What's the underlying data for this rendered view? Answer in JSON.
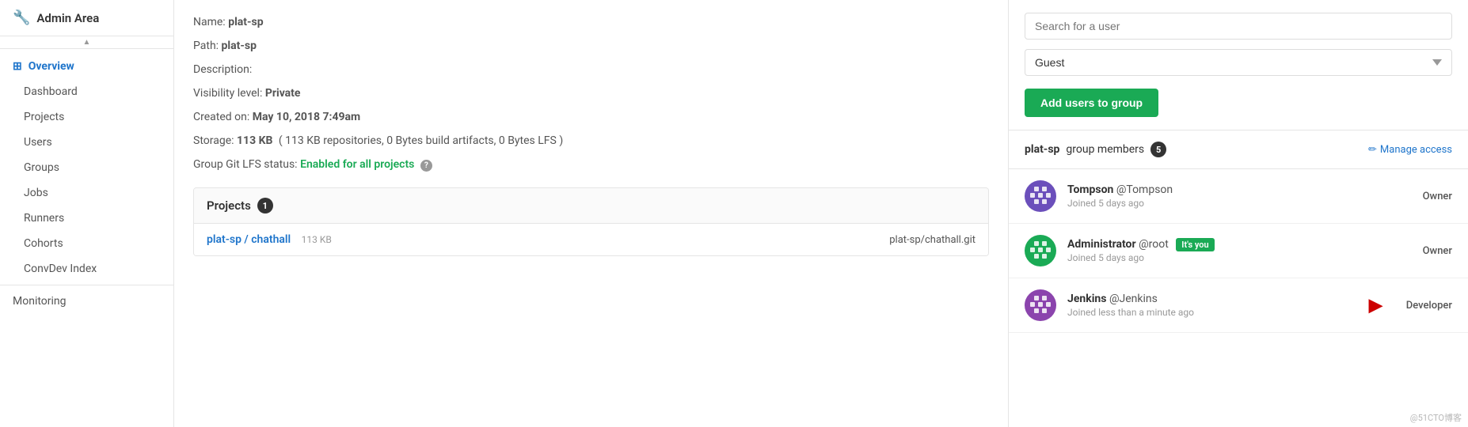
{
  "sidebar": {
    "header": {
      "title": "Admin Area",
      "icon": "wrench"
    },
    "items": [
      {
        "id": "overview",
        "label": "Overview",
        "icon": "grid",
        "active": true,
        "class": "overview"
      },
      {
        "id": "dashboard",
        "label": "Dashboard",
        "icon": "",
        "active": false
      },
      {
        "id": "projects",
        "label": "Projects",
        "icon": "",
        "active": false
      },
      {
        "id": "users",
        "label": "Users",
        "icon": "",
        "active": false
      },
      {
        "id": "groups",
        "label": "Groups",
        "icon": "",
        "active": false,
        "highlighted": true
      },
      {
        "id": "jobs",
        "label": "Jobs",
        "icon": "",
        "active": false
      },
      {
        "id": "runners",
        "label": "Runners",
        "icon": "",
        "active": false
      },
      {
        "id": "cohorts",
        "label": "Cohorts",
        "icon": "",
        "active": false
      },
      {
        "id": "convdev",
        "label": "ConvDev Index",
        "icon": "",
        "active": false
      }
    ],
    "sections": [
      {
        "id": "monitoring",
        "label": "Monitoring"
      }
    ]
  },
  "group_detail": {
    "name_label": "Name:",
    "name_value": "plat-sp",
    "path_label": "Path:",
    "path_value": "plat-sp",
    "description_label": "Description:",
    "description_value": "",
    "visibility_label": "Visibility level:",
    "visibility_value": "Private",
    "created_label": "Created on:",
    "created_value": "May 10, 2018 7:49am",
    "storage_label": "Storage:",
    "storage_value": "113 KB",
    "storage_detail": "( 113 KB repositories, 0 Bytes build artifacts, 0 Bytes LFS )",
    "lfs_label": "Group Git LFS status:",
    "lfs_value": "Enabled for all projects"
  },
  "projects_section": {
    "title": "Projects",
    "count": "1",
    "project": {
      "link_text": "plat-sp / chathall",
      "size": "113 KB",
      "git_url": "plat-sp/chathall.git"
    }
  },
  "add_users": {
    "search_placeholder": "Search for a user",
    "role_value": "Guest",
    "button_label": "Add users to group"
  },
  "members": {
    "group_name": "plat-sp",
    "label": "group members",
    "count": "5",
    "manage_link": "Manage access",
    "list": [
      {
        "name": "Tompson",
        "username": "@Tompson",
        "joined": "Joined 5 days ago",
        "role": "Owner",
        "avatar_color": "#6b4fbb",
        "its_you": false
      },
      {
        "name": "Administrator",
        "username": "@root",
        "joined": "Joined 5 days ago",
        "role": "Owner",
        "avatar_color": "#1aaa55",
        "its_you": true,
        "its_you_label": "It's you"
      },
      {
        "name": "Jenkins",
        "username": "@Jenkins",
        "joined": "Joined less than a minute ago",
        "role": "Developer",
        "avatar_color": "#8b44ad",
        "its_you": false
      }
    ]
  },
  "watermark": "@51CTO博客"
}
